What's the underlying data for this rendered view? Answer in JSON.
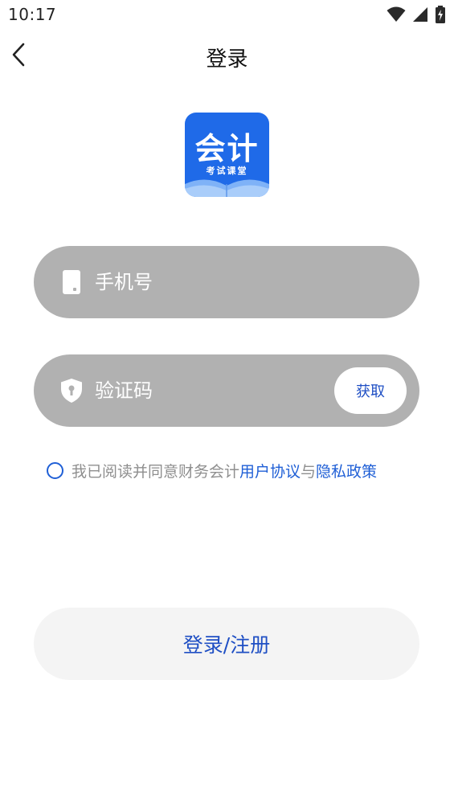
{
  "status_bar": {
    "time": "10:17",
    "icons": [
      "wifi-icon",
      "signal-icon",
      "battery-charging-icon"
    ]
  },
  "header": {
    "back_icon": "chevron-left-icon",
    "title": "登录"
  },
  "logo": {
    "title": "会计",
    "subtitle": "考试课堂",
    "bg_color": "#1f6ae8"
  },
  "form": {
    "phone": {
      "icon": "phone-icon",
      "placeholder": "手机号",
      "value": ""
    },
    "code": {
      "icon": "shield-icon",
      "placeholder": "验证码",
      "value": "",
      "get_code_label": "获取"
    }
  },
  "agreement": {
    "checked": false,
    "prefix": "我已阅读并同意财务会计",
    "user_agreement": "用户协议",
    "conjunction": "与",
    "privacy_policy": "隐私政策"
  },
  "login_button": {
    "label": "登录/注册"
  },
  "colors": {
    "accent": "#1f5fd6",
    "input_bg": "#b1b1b1",
    "button_bg": "#f4f4f4",
    "muted_text": "#8f8f8f"
  }
}
